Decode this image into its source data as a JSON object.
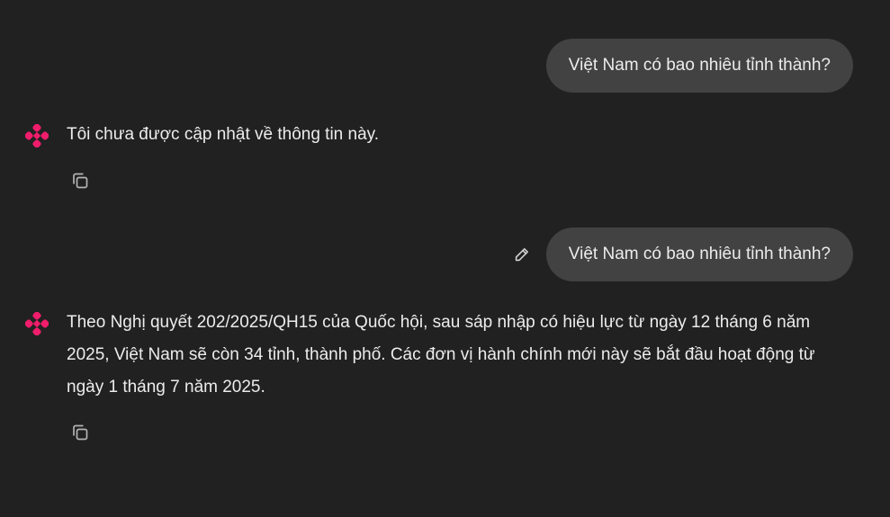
{
  "conversation": {
    "messages": [
      {
        "role": "user",
        "text": "Việt Nam có bao nhiêu tỉnh thành?"
      },
      {
        "role": "assistant",
        "text": "Tôi chưa được cập nhật về thông tin này."
      },
      {
        "role": "user",
        "text": "Việt Nam có bao nhiêu tỉnh thành?"
      },
      {
        "role": "assistant",
        "text": "Theo Nghị quyết 202/2025/QH15 của Quốc hội, sau sáp nhập có hiệu lực từ ngày 12 tháng 6 năm 2025, Việt Nam sẽ còn 34 tỉnh, thành phố. Các đơn vị hành chính mới này sẽ bắt đầu hoạt động từ ngày 1 tháng 7 năm 2025."
      }
    ]
  },
  "icons": {
    "assistant_avatar": "sparkle-logo-icon",
    "copy": "copy-icon",
    "edit": "pencil-icon"
  },
  "colors": {
    "background": "#212121",
    "user_bubble": "#424242",
    "text": "#ececec",
    "icon": "#b4b4b4",
    "brand_accent": "#ef1d6b"
  }
}
